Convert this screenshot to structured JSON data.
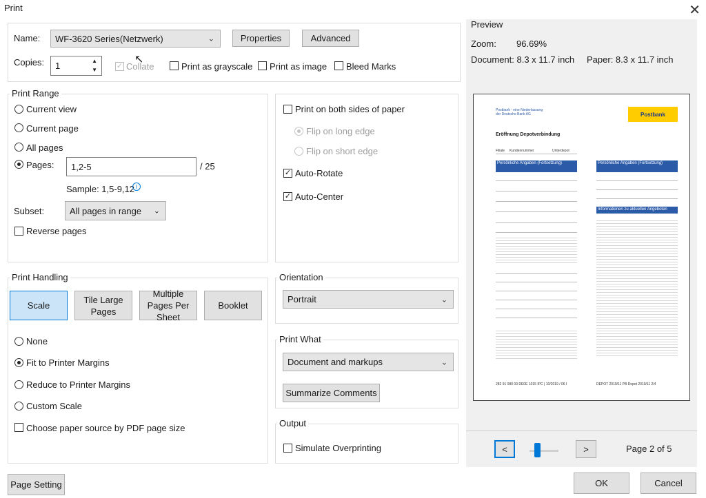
{
  "window": {
    "title": "Print"
  },
  "printer": {
    "name_label": "Name:",
    "name_value": "WF-3620 Series(Netzwerk)",
    "properties_label": "Properties",
    "advanced_label": "Advanced",
    "copies_label": "Copies:",
    "copies_value": "1",
    "collate_label": "Collate",
    "grayscale_label": "Print as grayscale",
    "image_label": "Print as image",
    "bleed_label": "Bleed Marks"
  },
  "print_range": {
    "title": "Print Range",
    "current_view": "Current view",
    "current_page": "Current page",
    "all_pages": "All pages",
    "pages_label": "Pages:",
    "pages_value": "1,2-5",
    "pages_total": "/ 25",
    "sample": "Sample: 1,5-9,12",
    "subset_label": "Subset:",
    "subset_value": "All pages in range",
    "reverse_label": "Reverse pages"
  },
  "duplex": {
    "both_sides": "Print on both sides of paper",
    "flip_long": "Flip on long edge",
    "flip_short": "Flip on short edge",
    "auto_rotate": "Auto-Rotate",
    "auto_center": "Auto-Center"
  },
  "handling": {
    "title": "Print Handling",
    "scale": "Scale",
    "tile": "Tile Large Pages",
    "multiple": "Multiple Pages Per Sheet",
    "booklet": "Booklet",
    "none": "None",
    "fit": "Fit to Printer Margins",
    "reduce": "Reduce to Printer Margins",
    "custom": "Custom Scale",
    "paper_source": "Choose paper source by PDF page size"
  },
  "orientation": {
    "title": "Orientation",
    "value": "Portrait"
  },
  "print_what": {
    "title": "Print What",
    "value": "Document and markups",
    "summarize": "Summarize Comments"
  },
  "output": {
    "title": "Output",
    "simulate": "Simulate Overprinting"
  },
  "preview": {
    "title": "Preview",
    "zoom_label": "Zoom:",
    "zoom_value": "96.69%",
    "document_label": "Document: 8.3 x 11.7 inch",
    "paper_label": "Paper: 8.3 x 11.7 inch",
    "page_status": "Page 2 of 5",
    "prev": "<",
    "next": ">",
    "doc": {
      "bank_line1": "Postbank - eine Niederlassung",
      "bank_line2": "der Deutsche Bank AG",
      "logo": "Postbank",
      "heading": "Eröffnung Depotverbindung",
      "field1": "Filiale",
      "field2": "Kundennummer",
      "field3": "Unterdepot",
      "left_bar": "Persönliche Angaben (Fortsetzung)",
      "right_bar": "Persönliche Angaben (Fortsetzung)",
      "right_bar2": "Informationen zu aktuellen Angeboten",
      "footer_left": "282 91 080 03 DE0E 1015 IPC | 10/2019 / 06 I",
      "footer_right": "DEPOT 2019/11 PB Depot 2019/11 2/4",
      "footer_page": "2/4"
    }
  },
  "footer": {
    "page_setting": "Page Setting",
    "ok": "OK",
    "cancel": "Cancel"
  },
  "colors": {
    "accent": "#0078d7",
    "selected_bg": "#cce4f7",
    "bank_blue": "#2b5aa8",
    "logo_yellow": "#ffcc00"
  }
}
